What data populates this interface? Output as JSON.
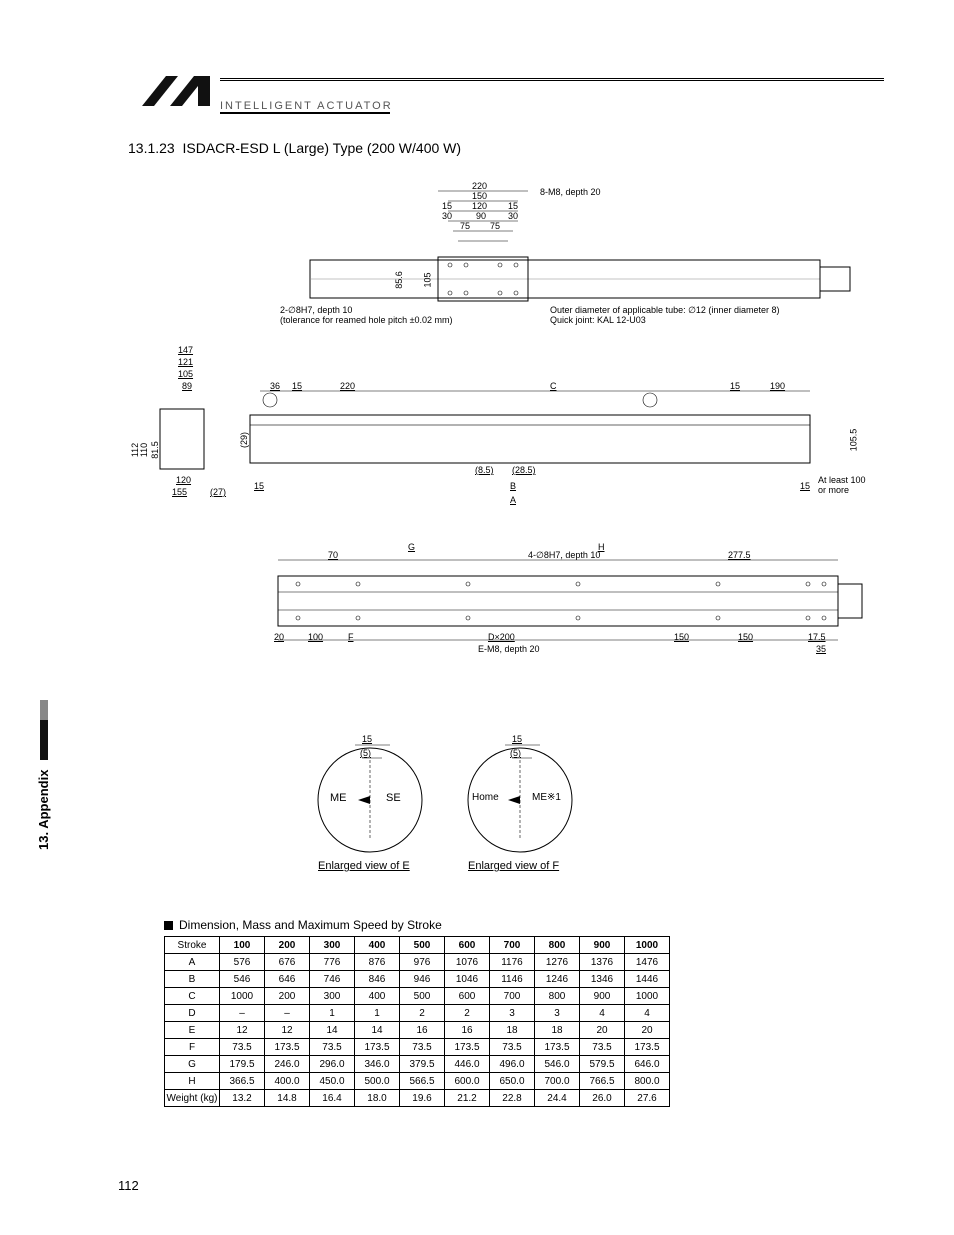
{
  "header": {
    "brand": "INTELLIGENT ACTUATOR"
  },
  "section": {
    "number": "13.1.23",
    "title": "ISDACR-ESD L (Large) Type (200 W/400 W)"
  },
  "sidebar": {
    "label": "13. Appendix"
  },
  "fig_top": {
    "dims_horiz_top": [
      "220",
      "150",
      "15",
      "120",
      "15",
      "30",
      "90",
      "30",
      "75",
      "75"
    ],
    "note_holes": "8-M8, depth 20",
    "v_dims": [
      "85.6",
      "105"
    ],
    "reamed_note_a": "2-∅8H7, depth 10",
    "reamed_note_b": "(tolerance for reamed hole pitch ±0.02 mm)",
    "tube_note": "Outer diameter of applicable tube: ∅12 (inner diameter 8)",
    "joint_note": "Quick joint: KAL 12-U03"
  },
  "fig_side": {
    "left_stack": [
      "147",
      "121",
      "105",
      "89"
    ],
    "left_v": [
      "112",
      "110",
      "81.5"
    ],
    "left_bottom": [
      "120",
      "155",
      "(27)"
    ],
    "inner": [
      "36",
      "15",
      "220",
      "C",
      "15",
      "190"
    ],
    "right_v": "105.5",
    "inner2": [
      "(29)",
      "(8.5)",
      "(28.5)",
      "15",
      "B",
      "15",
      "At least 100",
      "or more",
      "A"
    ]
  },
  "fig_plan": {
    "top": [
      "G",
      "H",
      "4-∅8H7, depth 10",
      "277.5",
      "70"
    ],
    "bottom": [
      "20",
      "100",
      "F",
      "D×200",
      "E-M8, depth 20",
      "150",
      "150",
      "17.5",
      "35"
    ]
  },
  "fig_detail": {
    "e": {
      "d1": "15",
      "d2": "(5)",
      "l": "ME",
      "r": "SE"
    },
    "f": {
      "d1": "15",
      "d2": "(5)",
      "l": "Home",
      "r": "ME※1"
    },
    "cap_e": "Enlarged view of E",
    "cap_f": "Enlarged view of F"
  },
  "chart_data": {
    "type": "table",
    "title": "Dimension, Mass and Maximum Speed by Stroke",
    "columns": [
      "Stroke",
      "100",
      "200",
      "300",
      "400",
      "500",
      "600",
      "700",
      "800",
      "900",
      "1000"
    ],
    "rows": [
      {
        "label": "A",
        "values": [
          "576",
          "676",
          "776",
          "876",
          "976",
          "1076",
          "1176",
          "1276",
          "1376",
          "1476"
        ]
      },
      {
        "label": "B",
        "values": [
          "546",
          "646",
          "746",
          "846",
          "946",
          "1046",
          "1146",
          "1246",
          "1346",
          "1446"
        ]
      },
      {
        "label": "C",
        "values": [
          "1000",
          "200",
          "300",
          "400",
          "500",
          "600",
          "700",
          "800",
          "900",
          "1000"
        ]
      },
      {
        "label": "D",
        "values": [
          "–",
          "–",
          "1",
          "1",
          "2",
          "2",
          "3",
          "3",
          "4",
          "4"
        ]
      },
      {
        "label": "E",
        "values": [
          "12",
          "12",
          "14",
          "14",
          "16",
          "16",
          "18",
          "18",
          "20",
          "20"
        ]
      },
      {
        "label": "F",
        "values": [
          "73.5",
          "173.5",
          "73.5",
          "173.5",
          "73.5",
          "173.5",
          "73.5",
          "173.5",
          "73.5",
          "173.5"
        ]
      },
      {
        "label": "G",
        "values": [
          "179.5",
          "246.0",
          "296.0",
          "346.0",
          "379.5",
          "446.0",
          "496.0",
          "546.0",
          "579.5",
          "646.0"
        ]
      },
      {
        "label": "H",
        "values": [
          "366.5",
          "400.0",
          "450.0",
          "500.0",
          "566.5",
          "600.0",
          "650.0",
          "700.0",
          "766.5",
          "800.0"
        ]
      },
      {
        "label": "Weight (kg)",
        "values": [
          "13.2",
          "14.8",
          "16.4",
          "18.0",
          "19.6",
          "21.2",
          "22.8",
          "24.4",
          "26.0",
          "27.6"
        ]
      }
    ]
  },
  "page_number": "112"
}
